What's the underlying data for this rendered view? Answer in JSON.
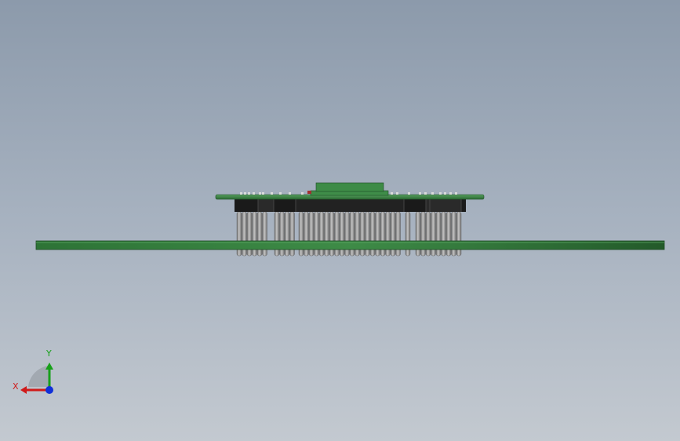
{
  "viewport": {
    "background_top": "#8c9aab",
    "background_bottom": "#c3c9d0"
  },
  "model": {
    "pcb_color": "#3c8a46",
    "pcb_edge_color": "#1d4a24",
    "connector_color": "#1a1a1a",
    "pin_color": "#9a9a9a"
  },
  "triad": {
    "x_label": "X",
    "y_label": "Y",
    "x_color": "#d01a1a",
    "y_color": "#17a01a",
    "z_color": "#1030d8",
    "x_icon": "x-axis-arrow-icon",
    "y_icon": "y-axis-arrow-icon",
    "z_icon": "z-axis-dot-icon"
  }
}
